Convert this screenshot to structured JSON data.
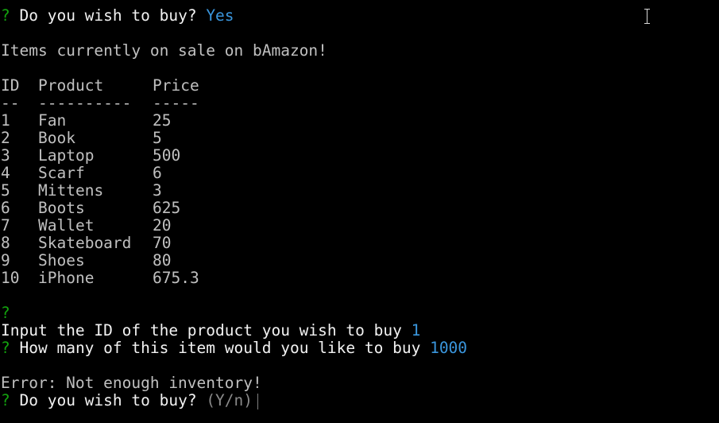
{
  "prompts": {
    "marker": "?",
    "buy_question": "Do you wish to buy?",
    "buy_answer": "Yes",
    "id_question": "Input the ID of the product you wish to buy",
    "id_answer": "1",
    "qty_question": "How many of this item would you like to buy",
    "qty_answer": "1000",
    "buy_again_question": "Do you wish to buy?",
    "buy_again_hint": "(Y/n)"
  },
  "heading": "Items currently on sale on bAmazon!",
  "table": {
    "headers": {
      "id": "ID",
      "product": "Product",
      "price": "Price"
    },
    "separators": {
      "id": "--",
      "product": "----------",
      "price": "-----"
    },
    "rows": [
      {
        "id": "1",
        "product": "Fan",
        "price": "25"
      },
      {
        "id": "2",
        "product": "Book",
        "price": "5"
      },
      {
        "id": "3",
        "product": "Laptop",
        "price": "500"
      },
      {
        "id": "4",
        "product": "Scarf",
        "price": "6"
      },
      {
        "id": "5",
        "product": "Mittens",
        "price": "3"
      },
      {
        "id": "6",
        "product": "Boots",
        "price": "625"
      },
      {
        "id": "7",
        "product": "Wallet",
        "price": "20"
      },
      {
        "id": "8",
        "product": "Skateboard",
        "price": "70"
      },
      {
        "id": "9",
        "product": "Shoes",
        "price": "80"
      },
      {
        "id": "10",
        "product": "iPhone",
        "price": "675.3"
      }
    ]
  },
  "error_message": "Error: Not enough inventory!",
  "colors": {
    "background": "#000000",
    "prompt_marker": "#13a10e",
    "answer": "#3a96dd",
    "text": "#c0c0c0"
  },
  "icons": {
    "mouse_cursor": "i-beam-cursor-icon"
  }
}
